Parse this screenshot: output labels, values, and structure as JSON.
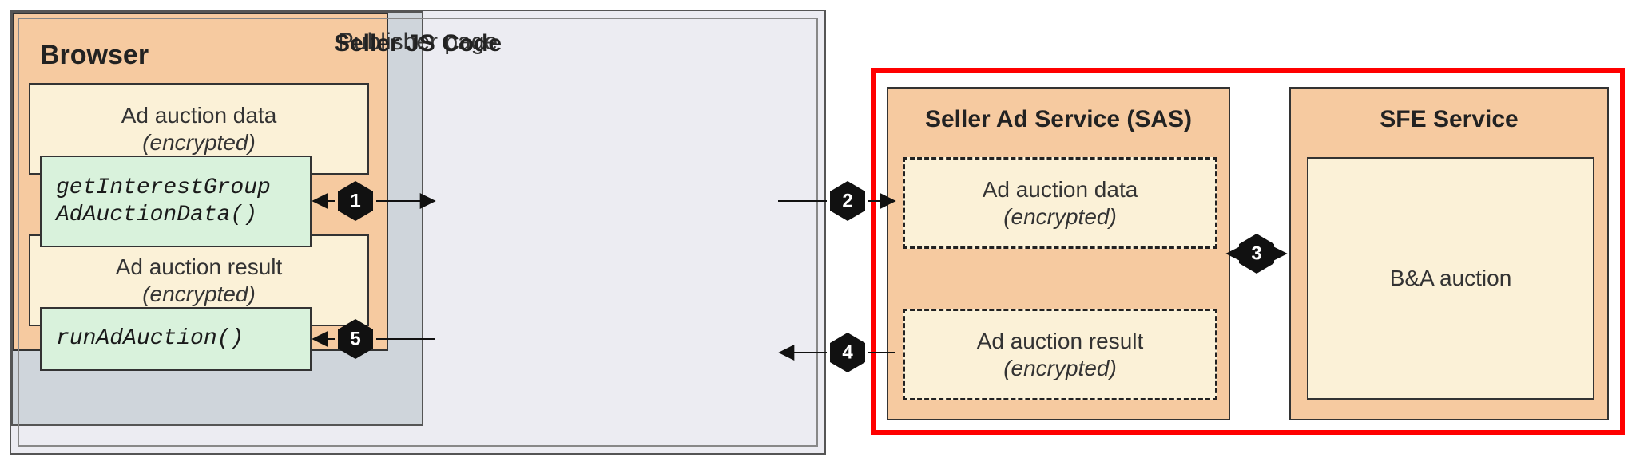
{
  "browser": {
    "title": "Browser",
    "api_get": "getInterestGroup\nAdAuctionData()",
    "api_run": "runAdAuction()"
  },
  "publisher": {
    "title": "Publisher page"
  },
  "sellerjs": {
    "title": "Seller JS Code",
    "data_label": "Ad auction data",
    "data_sub": "(encrypted)",
    "result_label": "Ad auction result",
    "result_sub": "(encrypted)"
  },
  "sas": {
    "title": "Seller Ad Service (SAS)",
    "data_label": "Ad auction data",
    "data_sub": "(encrypted)",
    "result_label": "Ad auction result",
    "result_sub": "(encrypted)"
  },
  "sfe": {
    "title": "SFE Service",
    "ba_label": "B&A auction"
  },
  "steps": {
    "s1": "1",
    "s2": "2",
    "s3": "3",
    "s4": "4",
    "s5": "5"
  }
}
